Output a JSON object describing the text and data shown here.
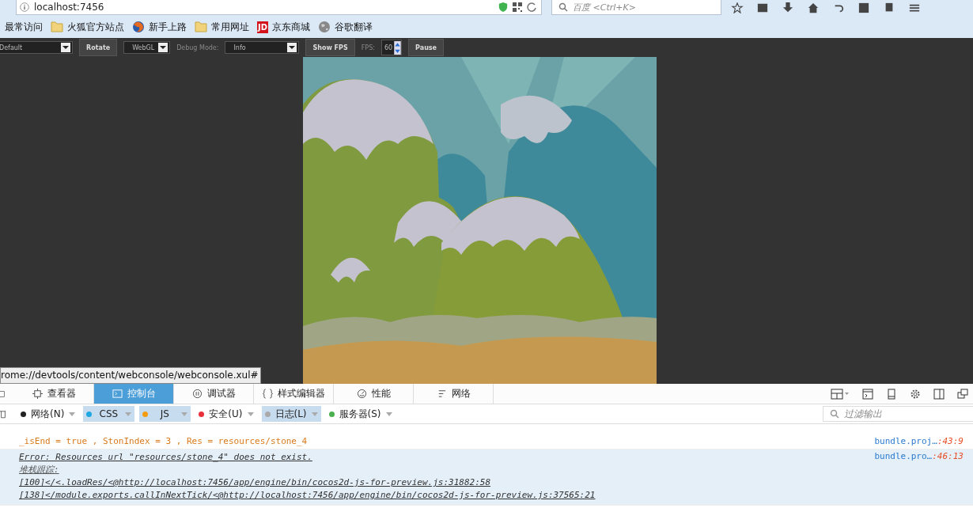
{
  "browser": {
    "address": "localhost:7456",
    "search_placeholder": "百度 <Ctrl+K>"
  },
  "bookmarks": [
    {
      "label": "最常访问",
      "kind": "plain"
    },
    {
      "label": "火狐官方站点",
      "kind": "folder"
    },
    {
      "label": "新手上路",
      "kind": "firefox"
    },
    {
      "label": "常用网址",
      "kind": "folder"
    },
    {
      "label": "京东商城",
      "kind": "jd",
      "badge": "JD"
    },
    {
      "label": "谷歌翻译",
      "kind": "globe"
    }
  ],
  "preview_toolbar": [
    {
      "kind": "select",
      "value": "Default"
    },
    {
      "kind": "button",
      "label": "Rotate"
    },
    {
      "kind": "select",
      "value": "WebGL"
    },
    {
      "kind": "label",
      "label": "Debug Mode:"
    },
    {
      "kind": "select",
      "value": "Info"
    },
    {
      "kind": "button",
      "label": "Show FPS"
    },
    {
      "kind": "label",
      "label": "FPS:"
    },
    {
      "kind": "spinner",
      "value": "60"
    },
    {
      "kind": "button",
      "label": "Pause"
    }
  ],
  "status_tooltip": "rome://devtools/content/webconsole/webconsole.xul#",
  "devtools_tabs": [
    {
      "label": "查看器",
      "selected": false
    },
    {
      "label": "控制台",
      "selected": true
    },
    {
      "label": "调试器",
      "selected": false
    },
    {
      "label": "样式编辑器",
      "selected": false
    },
    {
      "label": "性能",
      "selected": false
    },
    {
      "label": "网络",
      "selected": false
    }
  ],
  "console_filters": [
    {
      "label": "网络(N)",
      "color": "#222222",
      "selected": false
    },
    {
      "label": "CSS",
      "color": "#1ea7e0",
      "selected": true
    },
    {
      "label": "JS",
      "color": "#f39c12",
      "selected": true
    },
    {
      "label": "安全(U)",
      "color": "#e8313b",
      "selected": false
    },
    {
      "label": "日志(L)",
      "color": "#aaaaaa",
      "selected": true
    },
    {
      "label": "服务器(S)",
      "color": "#4caf50",
      "selected": false
    }
  ],
  "filter_placeholder": "过滤输出",
  "messages": [
    {
      "kind": "log",
      "lines": [
        "_isEnd = true , StonIndex = 3 , Res = resources/stone_4"
      ],
      "source": "bundle.proj…",
      "location": ":43:9"
    },
    {
      "kind": "error",
      "lines": [
        "Error: Resources url \"resources/stone_4\" does not exist.",
        "堆栈跟踪:",
        "[100]</<.loadRes/<@http://localhost:7456/app/engine/bin/cocos2d-js-for-preview.js:31882:58",
        "[138]</module.exports.callInNextTick/<@http://localhost:7456/app/engine/bin/cocos2d-js-for-preview.js:37565:21"
      ],
      "source": "bundle.pro…",
      "location": ":46:13"
    }
  ]
}
